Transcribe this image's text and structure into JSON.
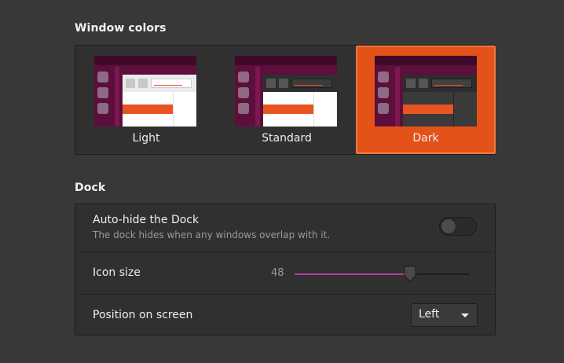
{
  "window_colors": {
    "title": "Window colors",
    "options": [
      {
        "label": "Light",
        "selected": false
      },
      {
        "label": "Standard",
        "selected": false
      },
      {
        "label": "Dark",
        "selected": true
      }
    ]
  },
  "dock": {
    "title": "Dock",
    "auto_hide": {
      "label": "Auto-hide the Dock",
      "description": "The dock hides when any windows overlap with it.",
      "enabled": false
    },
    "icon_size": {
      "label": "Icon size",
      "value": "48",
      "fraction": 0.66
    },
    "position": {
      "label": "Position on screen",
      "selected": "Left"
    }
  },
  "colors": {
    "accent": "#e35218",
    "slider_fill": "#aa3d9a",
    "background": "#383838",
    "panel": "#303030"
  }
}
